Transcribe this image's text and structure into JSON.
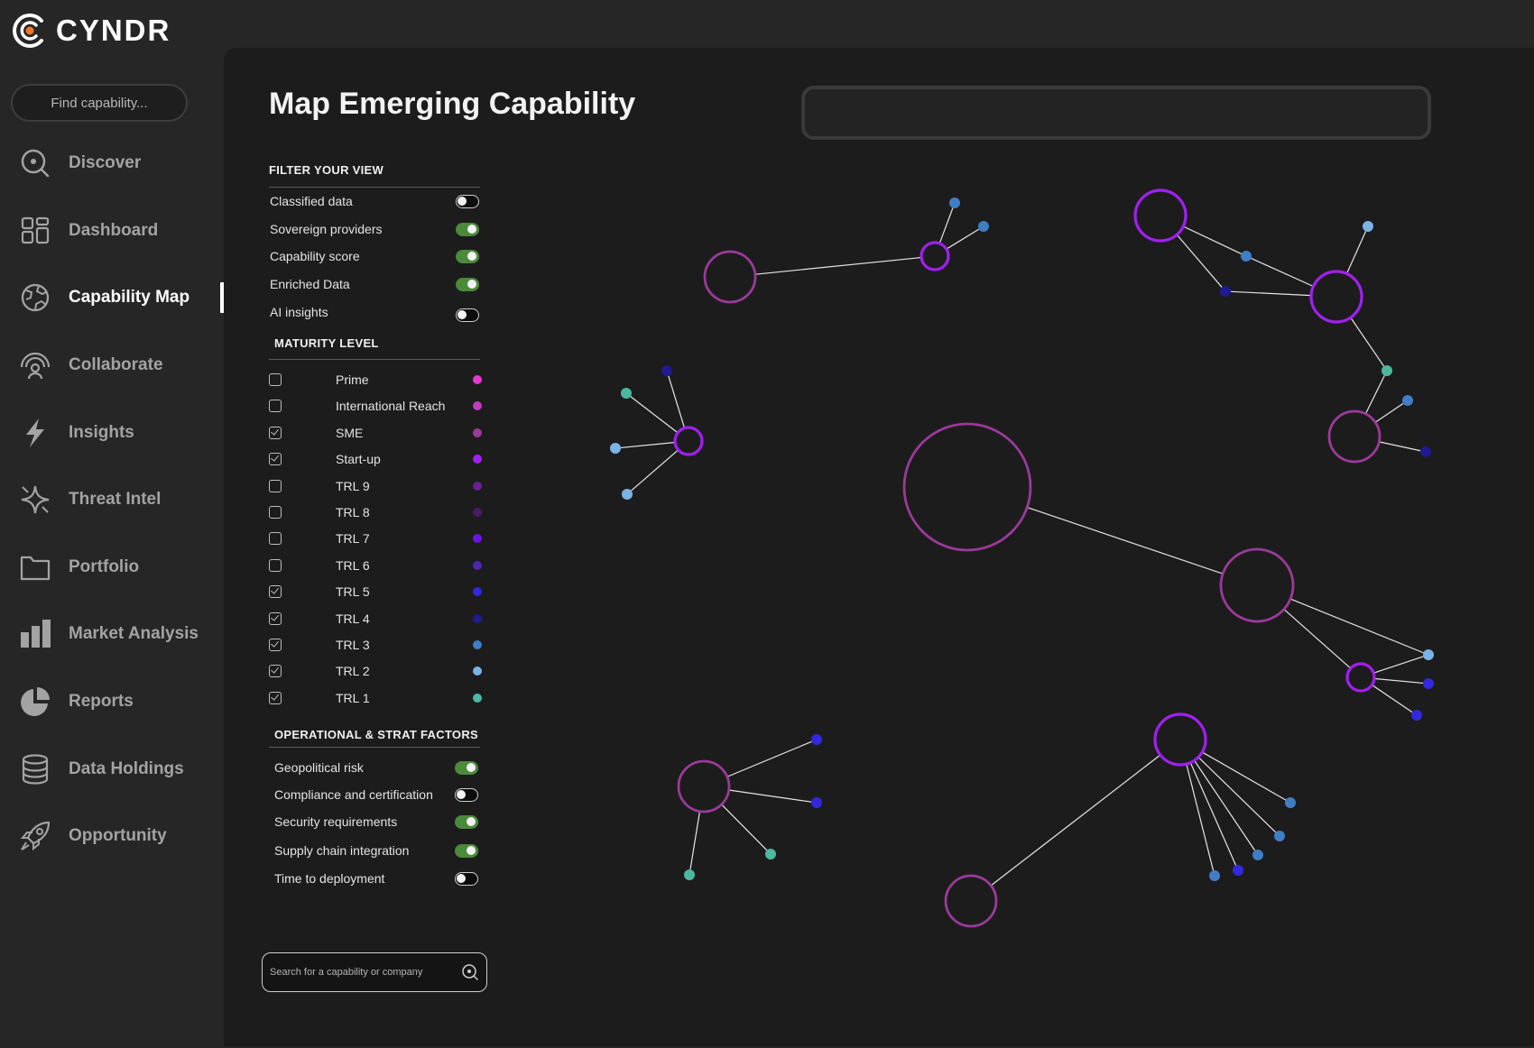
{
  "app": {
    "name": "CYNDR"
  },
  "sidebar": {
    "search_placeholder": "Find capability...",
    "items": [
      {
        "label": "Discover",
        "icon": "discover-icon"
      },
      {
        "label": "Dashboard",
        "icon": "dashboard-icon"
      },
      {
        "label": "Capability Map",
        "icon": "globe-icon",
        "active": true
      },
      {
        "label": "Collaborate",
        "icon": "collaborate-icon"
      },
      {
        "label": "Insights",
        "icon": "lightning-icon"
      },
      {
        "label": "Threat Intel",
        "icon": "sparkle-icon"
      },
      {
        "label": "Portfolio",
        "icon": "folder-icon"
      },
      {
        "label": "Market Analysis",
        "icon": "bar-chart-icon"
      },
      {
        "label": "Reports",
        "icon": "pie-chart-icon"
      },
      {
        "label": "Data Holdings",
        "icon": "database-icon"
      },
      {
        "label": "Opportunity",
        "icon": "rocket-icon"
      }
    ]
  },
  "main": {
    "title": "Map Emerging Capability",
    "filter": {
      "heading": "FILTER YOUR VIEW",
      "items": [
        {
          "label": "Classified data",
          "on": false
        },
        {
          "label": "Sovereign providers",
          "on": true
        },
        {
          "label": "Capability score",
          "on": true
        },
        {
          "label": "Enriched Data",
          "on": true
        },
        {
          "label": "AI insights",
          "on": false
        }
      ]
    },
    "maturity": {
      "heading": "MATURITY LEVEL",
      "items": [
        {
          "label": "Prime",
          "checked": false,
          "color": "#e838d0"
        },
        {
          "label": "International Reach",
          "checked": false,
          "color": "#c33cbf"
        },
        {
          "label": "SME",
          "checked": true,
          "color": "#9a3a9a"
        },
        {
          "label": "Start-up",
          "checked": true,
          "color": "#a020f0"
        },
        {
          "label": "TRL 9",
          "checked": false,
          "color": "#6a208f"
        },
        {
          "label": "TRL 8",
          "checked": false,
          "color": "#4d1a6a"
        },
        {
          "label": "TRL 7",
          "checked": false,
          "color": "#6a14e8"
        },
        {
          "label": "TRL 6",
          "checked": false,
          "color": "#4a28b0"
        },
        {
          "label": "TRL 5",
          "checked": true,
          "color": "#3328e0"
        },
        {
          "label": "TRL 4",
          "checked": true,
          "color": "#1f1a90"
        },
        {
          "label": "TRL 3",
          "checked": true,
          "color": "#3f7ec4"
        },
        {
          "label": "TRL 2",
          "checked": true,
          "color": "#7ab4e6"
        },
        {
          "label": "TRL 1",
          "checked": true,
          "color": "#4cb8a0"
        }
      ]
    },
    "factors": {
      "heading": "OPERATIONAL & STRAT FACTORS",
      "items": [
        {
          "label": "Geopolitical risk",
          "on": true
        },
        {
          "label": "Compliance and certification",
          "on": false
        },
        {
          "label": "Security requirements",
          "on": true
        },
        {
          "label": "Supply chain integration",
          "on": true
        },
        {
          "label": "Time to deployment",
          "on": false
        }
      ]
    },
    "bottom_search": {
      "placeholder": "Search for a capability or company"
    }
  },
  "graph": {
    "colors": {
      "big": "#9a3a9a",
      "mid": "#a020f0",
      "edge": "#e6e6e6",
      "trl1": "#4cb8a0",
      "trl2": "#7ab4e6",
      "trl3": "#3f7ec4",
      "trl4": "#1f1a90",
      "trl5": "#3328e0"
    },
    "nodes": [
      {
        "id": "c1",
        "kind": "big",
        "size": "medium"
      },
      {
        "id": "c1a",
        "kind": "mid",
        "size": "small"
      },
      {
        "id": "c1a1",
        "kind": "trl3"
      },
      {
        "id": "c1a2",
        "kind": "trl3"
      },
      {
        "id": "c2",
        "kind": "mid",
        "size": "medium"
      },
      {
        "id": "c2a",
        "kind": "trl3"
      },
      {
        "id": "c2b",
        "kind": "trl4"
      },
      {
        "id": "c2c",
        "kind": "mid",
        "size": "medium"
      },
      {
        "id": "c2d",
        "kind": "trl2"
      },
      {
        "id": "c2e",
        "kind": "trl1"
      },
      {
        "id": "c2f",
        "kind": "big",
        "size": "medium"
      },
      {
        "id": "c2g",
        "kind": "trl3"
      },
      {
        "id": "c2h",
        "kind": "trl4"
      },
      {
        "id": "c3",
        "kind": "mid",
        "size": "small"
      },
      {
        "id": "c3a",
        "kind": "trl4"
      },
      {
        "id": "c3b",
        "kind": "trl1"
      },
      {
        "id": "c3c",
        "kind": "trl2"
      },
      {
        "id": "c3d",
        "kind": "trl2"
      },
      {
        "id": "c4",
        "kind": "big",
        "size": "huge"
      },
      {
        "id": "c5",
        "kind": "big",
        "size": "large"
      },
      {
        "id": "c5a",
        "kind": "mid",
        "size": "small"
      },
      {
        "id": "c5b",
        "kind": "trl2"
      },
      {
        "id": "c5c",
        "kind": "trl5"
      },
      {
        "id": "c5d",
        "kind": "trl5"
      },
      {
        "id": "c6",
        "kind": "big",
        "size": "medium"
      },
      {
        "id": "c6a",
        "kind": "trl5"
      },
      {
        "id": "c6b",
        "kind": "trl5"
      },
      {
        "id": "c6c",
        "kind": "trl1"
      },
      {
        "id": "c6d",
        "kind": "trl1"
      },
      {
        "id": "c7",
        "kind": "mid",
        "size": "medium"
      },
      {
        "id": "c7a",
        "kind": "trl3"
      },
      {
        "id": "c7b",
        "kind": "trl3"
      },
      {
        "id": "c7c",
        "kind": "trl3"
      },
      {
        "id": "c7d",
        "kind": "trl5"
      },
      {
        "id": "c7e",
        "kind": "trl3"
      },
      {
        "id": "c8",
        "kind": "big",
        "size": "medium"
      }
    ],
    "edges": [
      [
        "c1",
        "c1a"
      ],
      [
        "c1a",
        "c1a1"
      ],
      [
        "c1a",
        "c1a2"
      ],
      [
        "c2",
        "c2a"
      ],
      [
        "c2",
        "c2b"
      ],
      [
        "c2a",
        "c2c"
      ],
      [
        "c2b",
        "c2c"
      ],
      [
        "c2c",
        "c2d"
      ],
      [
        "c2c",
        "c2e"
      ],
      [
        "c2e",
        "c2f"
      ],
      [
        "c2f",
        "c2g"
      ],
      [
        "c2f",
        "c2h"
      ],
      [
        "c3",
        "c3a"
      ],
      [
        "c3",
        "c3b"
      ],
      [
        "c3",
        "c3c"
      ],
      [
        "c3",
        "c3d"
      ],
      [
        "c4",
        "c5"
      ],
      [
        "c5",
        "c5a"
      ],
      [
        "c5",
        "c5b"
      ],
      [
        "c5a",
        "c5b"
      ],
      [
        "c5a",
        "c5c"
      ],
      [
        "c5a",
        "c5d"
      ],
      [
        "c6",
        "c6a"
      ],
      [
        "c6",
        "c6b"
      ],
      [
        "c6",
        "c6c"
      ],
      [
        "c6",
        "c6d"
      ],
      [
        "c7",
        "c7a"
      ],
      [
        "c7",
        "c7b"
      ],
      [
        "c7",
        "c7c"
      ],
      [
        "c7",
        "c7d"
      ],
      [
        "c7",
        "c7e"
      ],
      [
        "c7",
        "c8"
      ]
    ]
  }
}
